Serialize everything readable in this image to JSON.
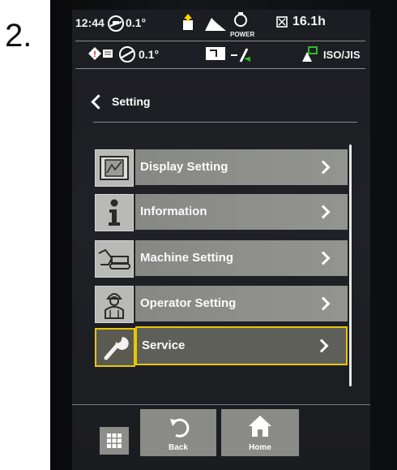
{
  "step_label": "2.",
  "status": {
    "time": "12:44",
    "angle_top": "0.1°",
    "power_label": "POWER",
    "hours": "16.1h",
    "angle_bottom": "0.1°",
    "pattern": "ISO/JIS"
  },
  "header": {
    "back_label": "Setting"
  },
  "menu": {
    "items": [
      {
        "label": "Display Setting",
        "icon": "display-icon"
      },
      {
        "label": "Information",
        "icon": "info-icon"
      },
      {
        "label": "Machine Setting",
        "icon": "excavator-icon"
      },
      {
        "label": "Operator Setting",
        "icon": "operator-icon"
      },
      {
        "label": "Service",
        "icon": "wrench-icon",
        "selected": true
      }
    ]
  },
  "footer": {
    "back_label": "Back",
    "home_label": "Home"
  },
  "colors": {
    "selected_border": "#e9c700",
    "item_bar": "#8f908c",
    "screen_bg": "#1e1f24"
  }
}
